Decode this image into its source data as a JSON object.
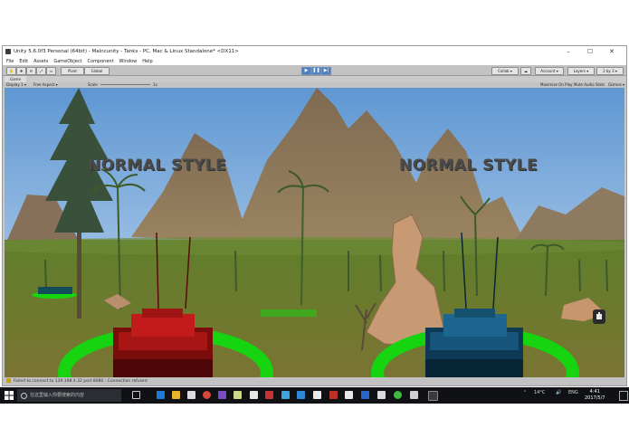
{
  "window": {
    "title": "Unity 5.6.0f3 Personal (64bit) - Maincunity - Tanks - PC, Mac & Linux Standalone* <DX11>",
    "min_glyph": "–",
    "max_glyph": "☐",
    "close_glyph": "✕"
  },
  "menu": [
    "File",
    "Edit",
    "Assets",
    "GameObject",
    "Component",
    "Window",
    "Help"
  ],
  "toolbar": {
    "pivot": "Pivot",
    "global": "Global",
    "collab": "Collab ▾",
    "account": "Account ▾",
    "layers": "Layers ▾",
    "layout": "2 by 3 ▾"
  },
  "game_panel": {
    "tab_label": "Game",
    "display": "Display 1 ▾",
    "aspect": "Free Aspect ▾",
    "scale_label": "Scale",
    "scale_value": "1x",
    "maximize": "Maximize On Play",
    "mute": "Mute Audio",
    "stats": "Stats",
    "gizmos": "Gizmos ▾"
  },
  "scene": {
    "left_label": "NORMAL STYLE",
    "right_label": "NORMAL STYLE",
    "colors": {
      "sky_top": "#5f97d3",
      "sky_bottom": "#c7dcef",
      "ground": "#6b7a2c",
      "ring": "#16d40f",
      "red_tank": "#b01010",
      "blue_tank": "#134c72"
    }
  },
  "status": {
    "message": "Failed to connect to 139.198.4.32 port 8080 : Connection refused"
  },
  "taskbar": {
    "search_placeholder": "在这里输入你要搜索的内容",
    "weather": "14°C",
    "lang": "ENG",
    "time": "4:41",
    "date": "2017/5/7",
    "icons": [
      "task-view-icon",
      "edge-icon",
      "file-explorer-icon",
      "store-icon",
      "chrome-icon",
      "visual-studio-icon",
      "notepad-icon",
      "git-icon",
      "unity-icon",
      "paint-icon",
      "photos-icon",
      "steam-icon",
      "media-icon",
      "acrobat-icon",
      "terminal-icon",
      "mail-icon",
      "wechat-icon",
      "settings-icon",
      "app-icon"
    ]
  }
}
